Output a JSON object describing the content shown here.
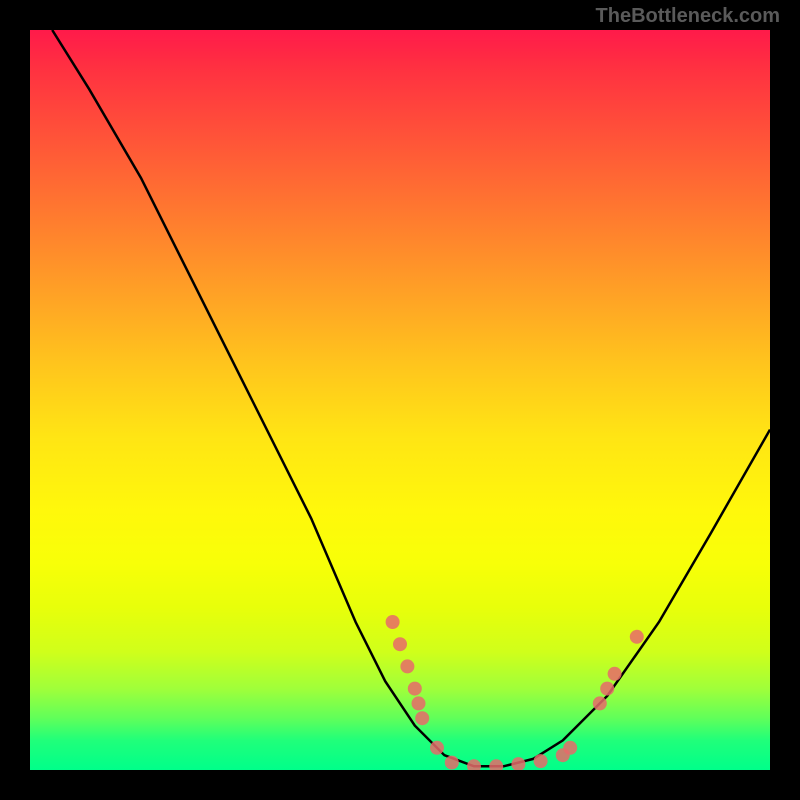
{
  "watermark": "TheBottleneck.com",
  "chart_data": {
    "type": "line",
    "title": "",
    "xlabel": "",
    "ylabel": "",
    "xlim": [
      0,
      100
    ],
    "ylim": [
      0,
      100
    ],
    "curve": [
      {
        "x": 3,
        "y": 100
      },
      {
        "x": 8,
        "y": 92
      },
      {
        "x": 15,
        "y": 80
      },
      {
        "x": 22,
        "y": 66
      },
      {
        "x": 30,
        "y": 50
      },
      {
        "x": 38,
        "y": 34
      },
      {
        "x": 44,
        "y": 20
      },
      {
        "x": 48,
        "y": 12
      },
      {
        "x": 52,
        "y": 6
      },
      {
        "x": 56,
        "y": 2
      },
      {
        "x": 60,
        "y": 0.5
      },
      {
        "x": 64,
        "y": 0.5
      },
      {
        "x": 68,
        "y": 1.5
      },
      {
        "x": 72,
        "y": 4
      },
      {
        "x": 78,
        "y": 10
      },
      {
        "x": 85,
        "y": 20
      },
      {
        "x": 92,
        "y": 32
      },
      {
        "x": 100,
        "y": 46
      }
    ],
    "scatter": [
      {
        "x": 49,
        "y": 20
      },
      {
        "x": 50,
        "y": 17
      },
      {
        "x": 51,
        "y": 14
      },
      {
        "x": 52,
        "y": 11
      },
      {
        "x": 52.5,
        "y": 9
      },
      {
        "x": 53,
        "y": 7
      },
      {
        "x": 55,
        "y": 3
      },
      {
        "x": 57,
        "y": 1
      },
      {
        "x": 60,
        "y": 0.5
      },
      {
        "x": 63,
        "y": 0.5
      },
      {
        "x": 66,
        "y": 0.8
      },
      {
        "x": 69,
        "y": 1.2
      },
      {
        "x": 72,
        "y": 2
      },
      {
        "x": 73,
        "y": 3
      },
      {
        "x": 77,
        "y": 9
      },
      {
        "x": 78,
        "y": 11
      },
      {
        "x": 79,
        "y": 13
      },
      {
        "x": 82,
        "y": 18
      }
    ],
    "colors": {
      "curve": "#000000",
      "scatter": "#e86a6a"
    }
  }
}
